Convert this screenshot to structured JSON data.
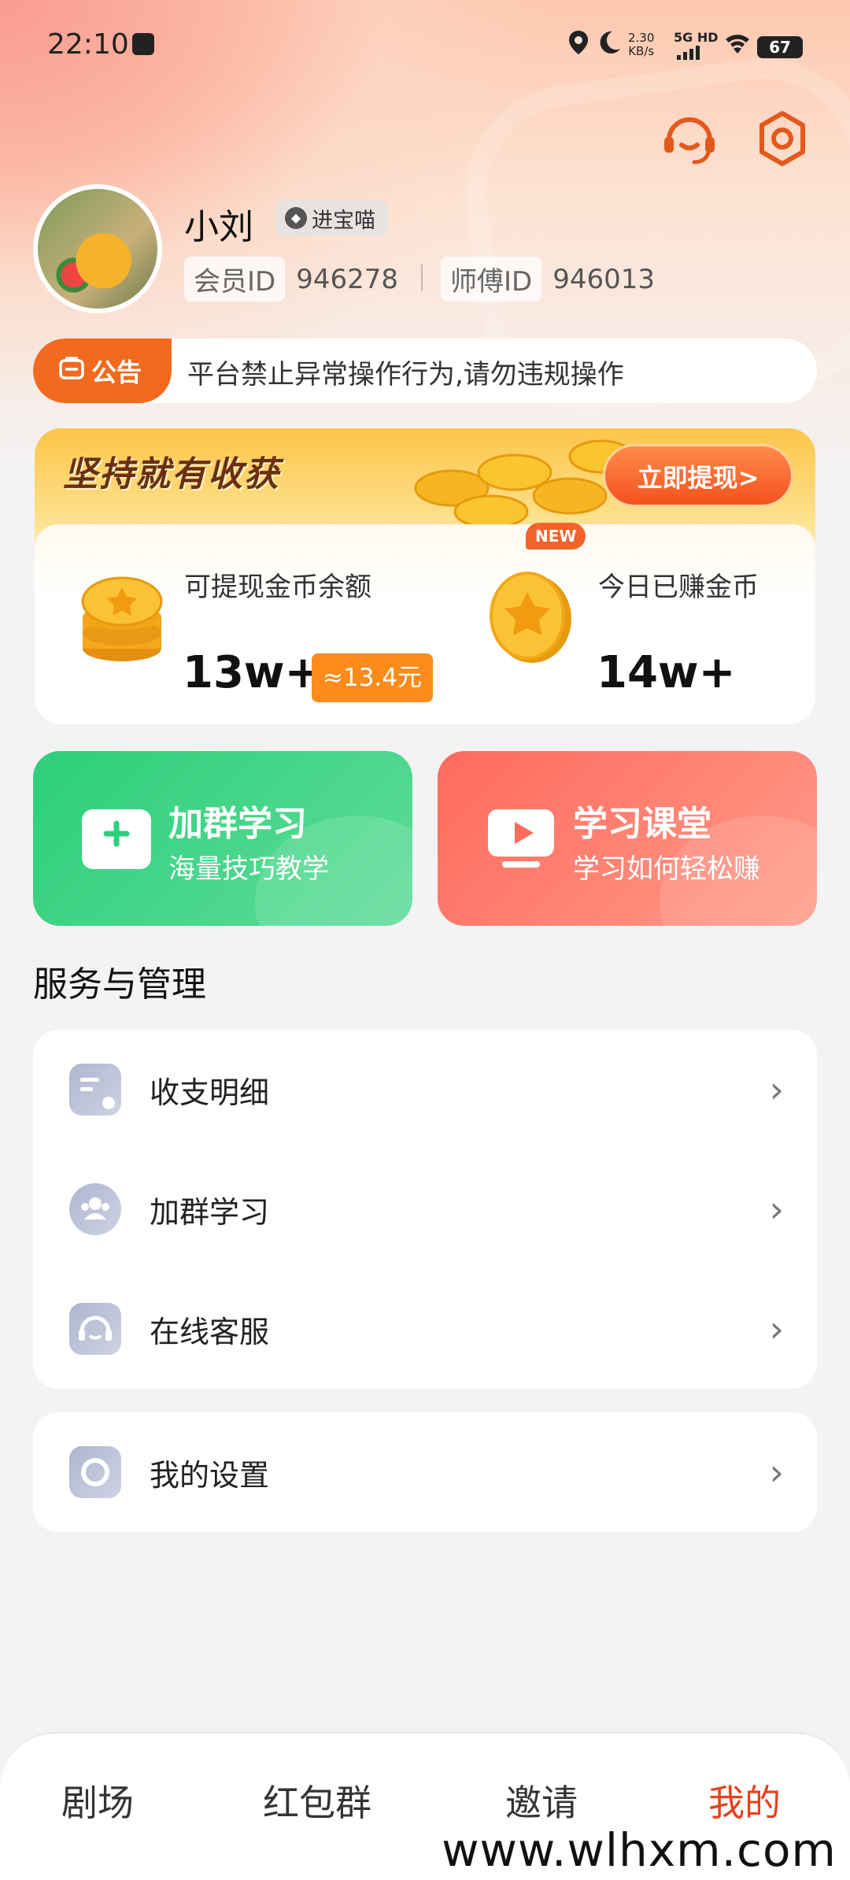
{
  "status_bar": {
    "time": "22:10",
    "speed_value": "2.30",
    "speed_unit": "KB/s",
    "network": "5G HD",
    "battery": "67"
  },
  "header": {
    "support_icon": "headset-icon",
    "settings_icon": "gear-icon"
  },
  "profile": {
    "name": "小刘",
    "tag": "进宝喵",
    "member_id_label": "会员ID",
    "member_id": "946278",
    "master_id_label": "师傅ID",
    "master_id": "946013"
  },
  "notice": {
    "badge": "公告",
    "text": "平台禁止异常操作行为,请勿违规操作"
  },
  "coin_card": {
    "slogan": "坚持就有收获",
    "withdraw_button": "立即提现>",
    "balance_label": "可提现金币余额",
    "balance_value": "13w+",
    "balance_approx": "≈13.4元",
    "new_badge": "NEW",
    "today_label": "今日已赚金币",
    "today_value": "14w+"
  },
  "actions": [
    {
      "title": "加群学习",
      "subtitle": "海量技巧教学",
      "icon": "chat-plus-icon",
      "color": "#2ccf7a"
    },
    {
      "title": "学习课堂",
      "subtitle": "学习如何轻松赚",
      "icon": "video-play-icon",
      "color": "#ff6a5c"
    }
  ],
  "services": {
    "title": "服务与管理",
    "items": [
      {
        "label": "收支明细",
        "icon": "document-icon"
      },
      {
        "label": "加群学习",
        "icon": "group-icon"
      },
      {
        "label": "在线客服",
        "icon": "headset-icon"
      }
    ],
    "settings": {
      "label": "我的设置",
      "icon": "gear-icon"
    }
  },
  "tabbar": {
    "tabs": [
      {
        "label": "剧场"
      },
      {
        "label": "红包群"
      },
      {
        "label": "邀请"
      },
      {
        "label": "我的"
      }
    ],
    "active": "我的"
  },
  "watermark": "www.wlhxm.com",
  "colors": {
    "accent": "#e8401c",
    "notice_orange": "#f26a1d",
    "green": "#2ccf7a",
    "red": "#ff6a5c",
    "coin_orange": "#fb8b1a"
  }
}
